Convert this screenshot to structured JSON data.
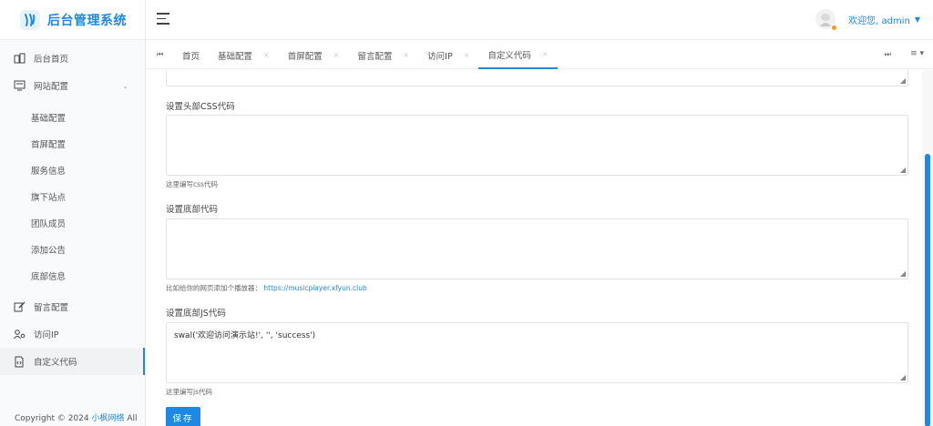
{
  "app": {
    "title": "后台管理系统"
  },
  "sidebar": {
    "items": [
      {
        "label": "后台首页",
        "icon": "dashboard-icon"
      },
      {
        "label": "网站配置",
        "icon": "monitor-icon",
        "expanded": true,
        "children": [
          "基础配置",
          "首屏配置",
          "服务信息",
          "旗下站点",
          "团队成员",
          "添加公告",
          "底部信息"
        ]
      },
      {
        "label": "留言配置",
        "icon": "edit-icon"
      },
      {
        "label": "访问IP",
        "icon": "users-icon"
      },
      {
        "label": "自定义代码",
        "icon": "code-file-icon",
        "active": true
      }
    ],
    "copyright_prefix": "Copyright © 2024",
    "copyright_link": "小枫网络",
    "copyright_suffix": "All"
  },
  "header": {
    "welcome": "欢迎您, admin"
  },
  "tabs": [
    {
      "label": "首页",
      "closable": false
    },
    {
      "label": "基础配置",
      "closable": true
    },
    {
      "label": "首屏配置",
      "closable": true
    },
    {
      "label": "留言配置",
      "closable": true
    },
    {
      "label": "访问IP",
      "closable": true
    },
    {
      "label": "自定义代码",
      "closable": true,
      "active": true
    }
  ],
  "form": {
    "head_css": {
      "label": "设置头部CSS代码",
      "value": "",
      "help": "这里编写css代码"
    },
    "footer_code": {
      "label": "设置底部代码",
      "value": "",
      "help_text": "比如给你的网页添加个播放器：",
      "help_link": "https://musicplayer.xfyun.club"
    },
    "footer_js": {
      "label": "设置底部JS代码",
      "value": "swal('欢迎访问演示站!', '', 'success')",
      "help": "这里编写js代码"
    },
    "save_label": "保存"
  },
  "colors": {
    "accent": "#1e88e5"
  }
}
